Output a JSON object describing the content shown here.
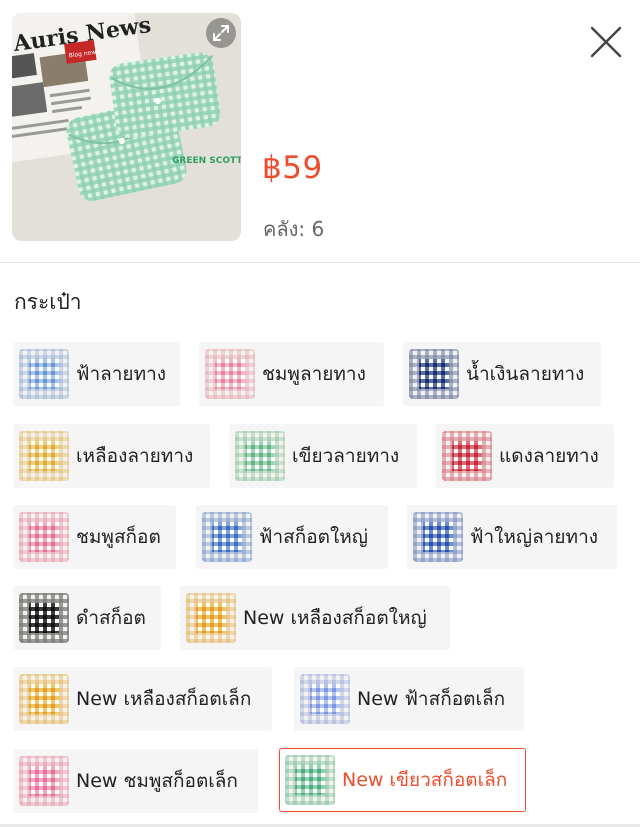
{
  "product": {
    "price": "฿59",
    "stock_label": "คลัง:",
    "stock_value": "6",
    "image": {
      "newspaper_headline": "Auris News",
      "blog_badge": "Blog news",
      "caption": "GREEN SCOTT"
    }
  },
  "section_title": "กระเป๋า",
  "variants": [
    {
      "label": "ฟ้าลายทาง",
      "color": "#a8c4ea",
      "stripe": "#ffffff"
    },
    {
      "label": "ชมพูลายทาง",
      "color": "#f2b9c8",
      "stripe": "#ffffff"
    },
    {
      "label": "น้ำเงินลายทาง",
      "color": "#5a6fa8",
      "stripe": "#ffffff"
    },
    {
      "label": "เหลืองลายทาง",
      "color": "#f0cf7a",
      "stripe": "#ffffff"
    },
    {
      "label": "เขียวลายทาง",
      "color": "#9fd6b6",
      "stripe": "#ffffff"
    },
    {
      "label": "แดงลายทาง",
      "color": "#e06a7a",
      "stripe": "#ffffff"
    },
    {
      "label": "ชมพูสก็อต",
      "color": "#f3a9bf",
      "stripe": "#ffffff"
    },
    {
      "label": "ฟ้าสก็อตใหญ่",
      "color": "#7fa7de",
      "stripe": "#ffffff"
    },
    {
      "label": "ฟ้าใหญ่ลายทาง",
      "color": "#6c8ed0",
      "stripe": "#ffffff"
    },
    {
      "label": "ดำสก็อต",
      "color": "#3a3a3a",
      "stripe": "#ffffff"
    },
    {
      "label": "New เหลืองสก็อตใหญ่",
      "color": "#f1c462",
      "stripe": "#ffffff"
    },
    {
      "label": "New เหลืองสก็อตเล็ก",
      "color": "#f2c866",
      "stripe": "#ffffff"
    },
    {
      "label": "New ฟ้าสก็อตเล็ก",
      "color": "#b3c3ef",
      "stripe": "#ffffff"
    },
    {
      "label": "New ชมพูสก็อตเล็ก",
      "color": "#f4a7c0",
      "stripe": "#ffffff"
    },
    {
      "label": "New เขียวสก็อตเล็ก",
      "color": "#8fd1b2",
      "stripe": "#ffffff"
    }
  ],
  "selected_variant": "New เขียวสก็อตเล็ก",
  "colors": {
    "accent": "#ee4d2d",
    "chip_bg": "#f5f5f5"
  }
}
